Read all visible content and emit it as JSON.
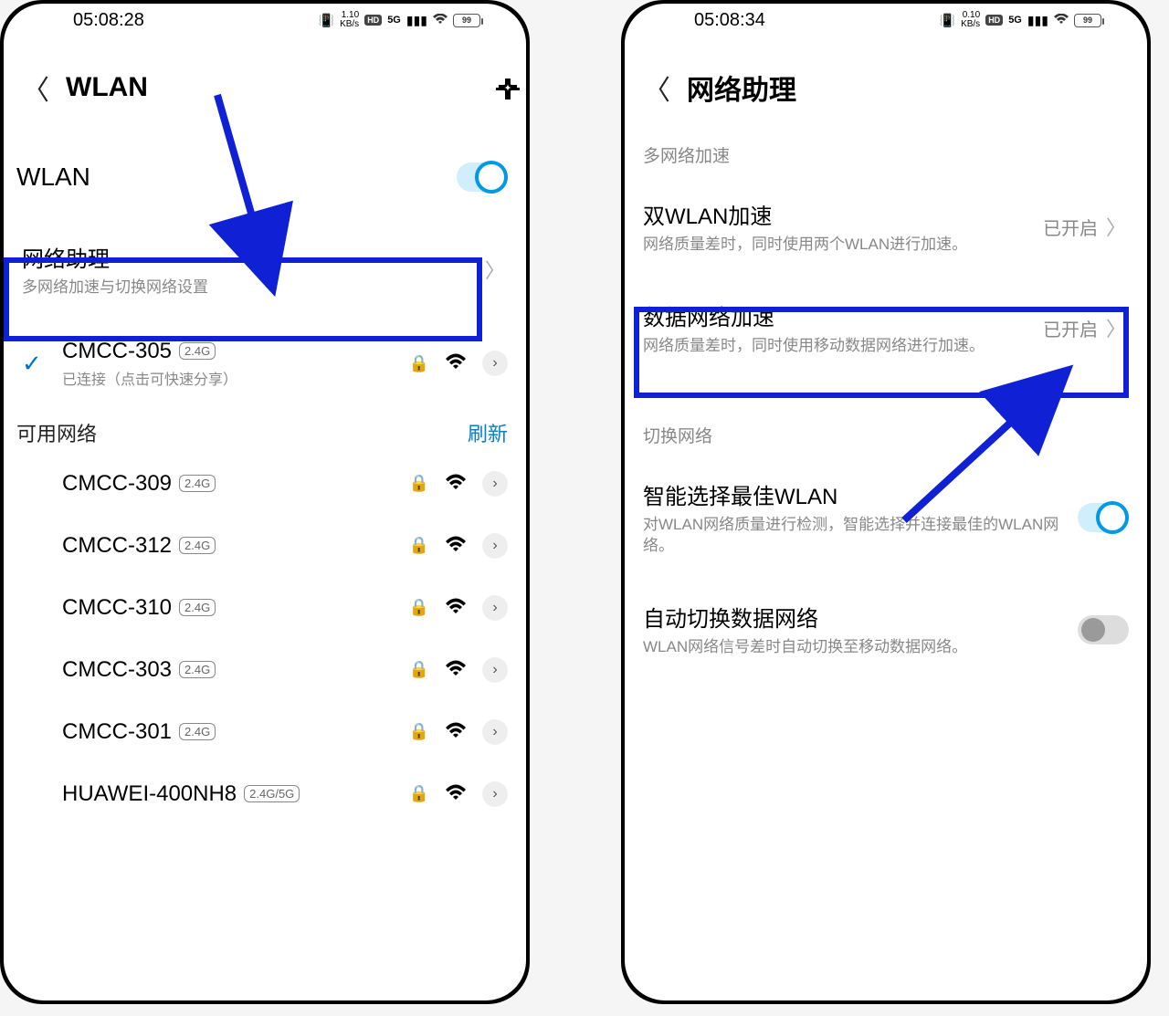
{
  "left": {
    "status": {
      "time": "05:08:28",
      "speed_top": "1.10",
      "speed_bot": "KB/s",
      "hd": "HD",
      "net": "5G",
      "battery": "99"
    },
    "header": {
      "title": "WLAN"
    },
    "wlan_label": "WLAN",
    "net_assist": {
      "title": "网络助理",
      "sub": "多网络加速与切换网络设置"
    },
    "connected": {
      "name": "CMCC-305",
      "band": "2.4G",
      "sub": "已连接（点击可快速分享）"
    },
    "available_label": "可用网络",
    "refresh": "刷新",
    "networks": [
      {
        "name": "CMCC-309",
        "band": "2.4G"
      },
      {
        "name": "CMCC-312",
        "band": "2.4G"
      },
      {
        "name": "CMCC-310",
        "band": "2.4G"
      },
      {
        "name": "CMCC-303",
        "band": "2.4G"
      },
      {
        "name": "CMCC-301",
        "band": "2.4G"
      },
      {
        "name": "HUAWEI-400NH8",
        "band": "2.4G/5G"
      }
    ]
  },
  "right": {
    "status": {
      "time": "05:08:34",
      "speed_top": "0.10",
      "speed_bot": "KB/s",
      "hd": "HD",
      "net": "5G",
      "battery": "99"
    },
    "header": {
      "title": "网络助理"
    },
    "group1": "多网络加速",
    "dual_wlan": {
      "title": "双WLAN加速",
      "sub": "网络质量差时，同时使用两个WLAN进行加速。",
      "state": "已开启"
    },
    "data_accel": {
      "title": "数据网络加速",
      "sub": "网络质量差时，同时使用移动数据网络进行加速。",
      "state": "已开启"
    },
    "group2": "切换网络",
    "smart_wlan": {
      "title": "智能选择最佳WLAN",
      "sub": "对WLAN网络质量进行检测，智能选择并连接最佳的WLAN网络。"
    },
    "auto_switch": {
      "title": "自动切换数据网络",
      "sub": "WLAN网络信号差时自动切换至移动数据网络。"
    }
  }
}
